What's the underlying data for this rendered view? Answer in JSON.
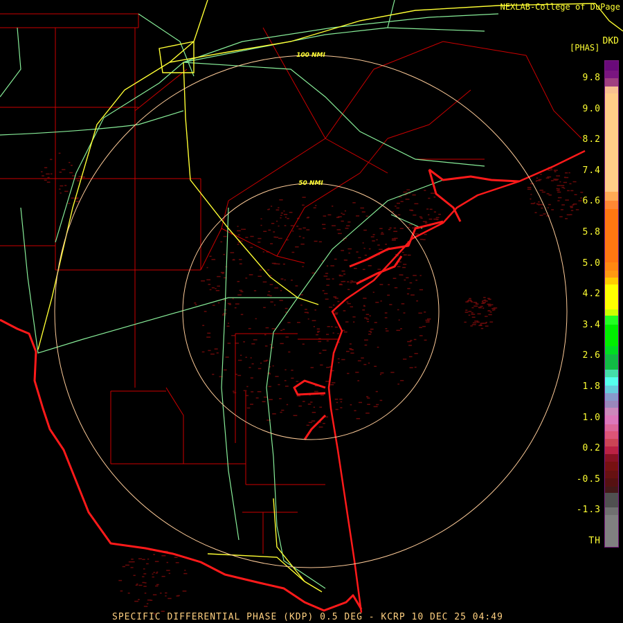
{
  "credit": "NEXLAB-College of DuPage",
  "product": "DKD",
  "unit": "[PHAS]",
  "rings": {
    "inner": "50 NMI",
    "outer": "100 NMI"
  },
  "legend": {
    "labels": [
      "9.8",
      "9.0",
      "8.2",
      "7.4",
      "6.6",
      "5.8",
      "5.0",
      "4.2",
      "3.4",
      "2.6",
      "1.8",
      "1.0",
      "0.2",
      "-0.5",
      "-1.3",
      "TH"
    ],
    "colors": [
      "#6a0a7a",
      "#7a1580",
      "#a04080",
      "#f8c090",
      "#ffcc88",
      "#ffaa55",
      "#ff8833",
      "#ff7711",
      "#ff8811",
      "#ff9911",
      "#ffcc00",
      "#ffff00",
      "#ccff00",
      "#22ff22",
      "#00ee00",
      "#00dd22",
      "#11bb44",
      "#44ddaa",
      "#55ffee",
      "#66ccdd",
      "#8899cc",
      "#9988bb",
      "#cc88bb",
      "#dd77bb",
      "#dd6699",
      "#dd5577",
      "#cc4455",
      "#bb2244",
      "#881122",
      "#771111",
      "#661111",
      "#551111",
      "#441818",
      "#505050",
      "#707070",
      "#808080"
    ]
  },
  "colors": {
    "coast": "#ff1a1a",
    "county": "#dd0000",
    "highway": "#ffff33",
    "road": "#88ee99",
    "ring": "#ffcc99",
    "echo": "#6a0a0a"
  },
  "caption": "SPECIFIC DIFFERENTIAL PHASE (KDP) 0.5 DEG - KCRP 10 DEC 25 04:49"
}
